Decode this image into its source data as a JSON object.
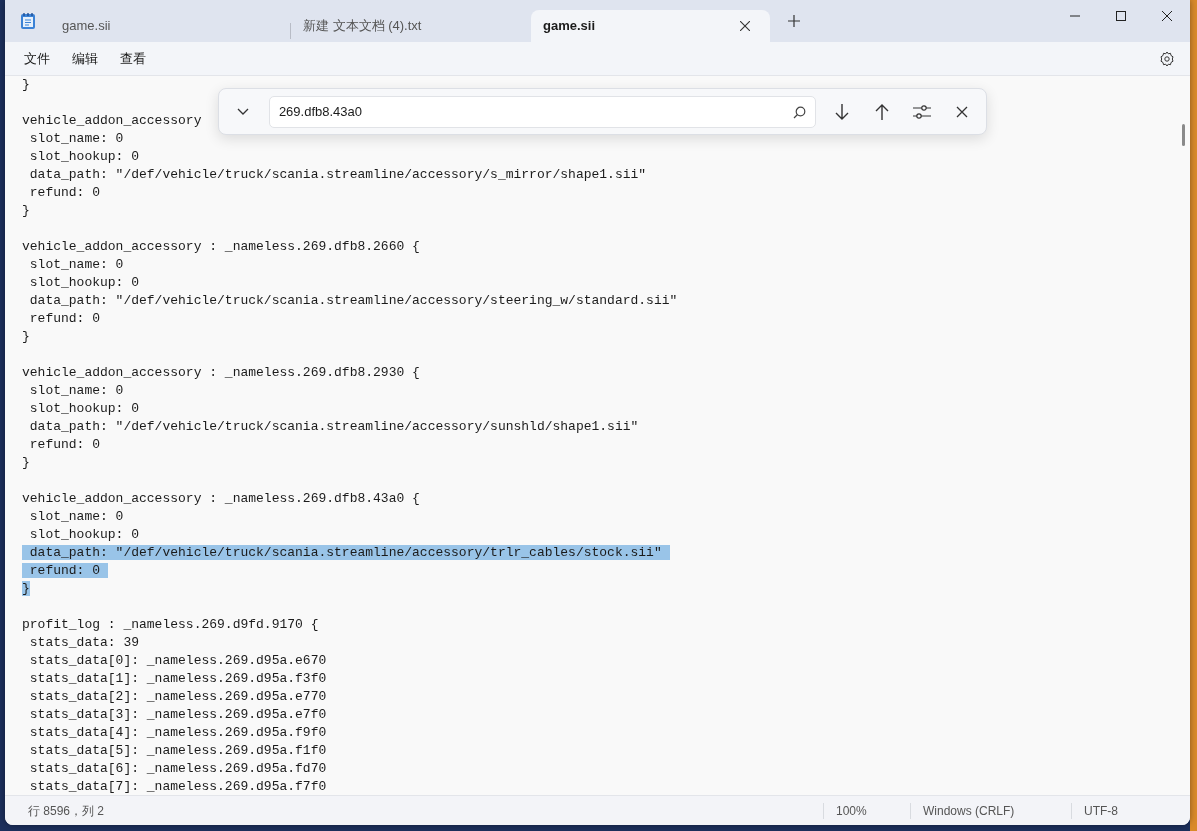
{
  "tabs": [
    {
      "label": "game.sii",
      "selected": false
    },
    {
      "label": "新建 文本文档 (4).txt",
      "selected": false
    },
    {
      "label": "game.sii",
      "selected": true
    }
  ],
  "menu": [
    "文件",
    "编辑",
    "查看"
  ],
  "find_bar": {
    "value": "269.dfb8.43a0"
  },
  "editor": {
    "lines": [
      {
        "text": "}",
        "selected": false
      },
      {
        "selected": false
      },
      {
        "text": "vehicle_addon_accessory",
        "selected": false
      },
      {
        "text": " slot_name: 0",
        "selected": false
      },
      {
        "text": " slot_hookup: 0",
        "selected": false
      },
      {
        "text": " data_path: \"/def/vehicle/truck/scania.streamline/accessory/s_mirror/shape1.sii\"",
        "selected": false
      },
      {
        "text": " refund: 0",
        "selected": false
      },
      {
        "text": "}",
        "selected": false
      },
      {
        "selected": false
      },
      {
        "text": "vehicle_addon_accessory : _nameless.269.dfb8.2660 {",
        "selected": false
      },
      {
        "text": " slot_name: 0",
        "selected": false
      },
      {
        "text": " slot_hookup: 0",
        "selected": false
      },
      {
        "text": " data_path: \"/def/vehicle/truck/scania.streamline/accessory/steering_w/standard.sii\"",
        "selected": false
      },
      {
        "text": " refund: 0",
        "selected": false
      },
      {
        "text": "}",
        "selected": false
      },
      {
        "selected": false
      },
      {
        "text": "vehicle_addon_accessory : _nameless.269.dfb8.2930 {",
        "selected": false
      },
      {
        "text": " slot_name: 0",
        "selected": false
      },
      {
        "text": " slot_hookup: 0",
        "selected": false
      },
      {
        "text": " data_path: \"/def/vehicle/truck/scania.streamline/accessory/sunshld/shape1.sii\"",
        "selected": false
      },
      {
        "text": " refund: 0",
        "selected": false
      },
      {
        "text": "}",
        "selected": false
      },
      {
        "selected": false
      },
      {
        "text": "vehicle_addon_accessory : _nameless.269.dfb8.43a0 {",
        "selected": false
      },
      {
        "text": " slot_name: 0",
        "selected": false
      },
      {
        "text": " slot_hookup: 0",
        "selected": false
      },
      {
        "text": " data_path: \"/def/vehicle/truck/scania.streamline/accessory/trlr_cables/stock.sii\"",
        "selected": true
      },
      {
        "text": " refund: 0",
        "selected": true
      },
      {
        "text": "}",
        "selected": true
      },
      {
        "selected": false
      },
      {
        "text": "profit_log : _nameless.269.d9fd.9170 {",
        "selected": false
      },
      {
        "text": " stats_data: 39",
        "selected": false
      },
      {
        "text": " stats_data[0]: _nameless.269.d95a.e670",
        "selected": false
      },
      {
        "text": " stats_data[1]: _nameless.269.d95a.f3f0",
        "selected": false
      },
      {
        "text": " stats_data[2]: _nameless.269.d95a.e770",
        "selected": false
      },
      {
        "text": " stats_data[3]: _nameless.269.d95a.e7f0",
        "selected": false
      },
      {
        "text": " stats_data[4]: _nameless.269.d95a.f9f0",
        "selected": false
      },
      {
        "text": " stats_data[5]: _nameless.269.d95a.f1f0",
        "selected": false
      },
      {
        "text": " stats_data[6]: _nameless.269.d95a.fd70",
        "selected": false
      },
      {
        "text": " stats_data[7]: _nameless.269.d95a.f7f0",
        "selected": false
      }
    ]
  },
  "status_bar": {
    "position": "行 8596，列 2",
    "zoom": "100%",
    "line_ending": "Windows (CRLF)",
    "encoding": "UTF-8"
  }
}
